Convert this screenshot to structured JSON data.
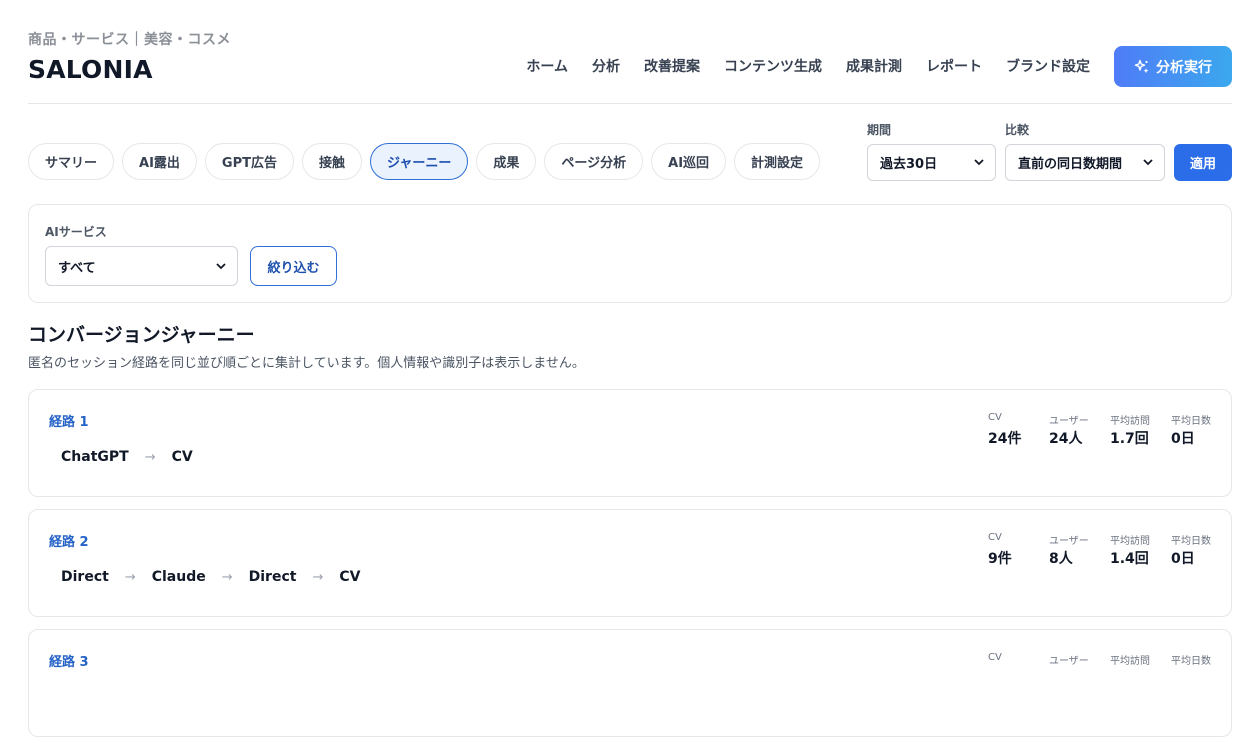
{
  "header": {
    "category": "商品・サービス｜美容・コスメ",
    "brand": "SALONIA",
    "nav": [
      "ホーム",
      "分析",
      "改善提案",
      "コンテンツ生成",
      "成果計測",
      "レポート",
      "ブランド設定"
    ],
    "run_button": "分析実行",
    "run_icon": "sparkle-icon"
  },
  "tabs": [
    "サマリー",
    "AI露出",
    "GPT広告",
    "接触",
    "ジャーニー",
    "成果",
    "ページ分析",
    "AI巡回",
    "計測設定"
  ],
  "active_tab": "ジャーニー",
  "filters": {
    "period_label": "期間",
    "period_value": "過去30日",
    "compare_label": "比較",
    "compare_value": "直前の同日数期間",
    "apply_button": "適用"
  },
  "service_filter": {
    "label": "AIサービス",
    "value": "すべて",
    "button": "絞り込む"
  },
  "section": {
    "title": "コンバージョンジャーニー",
    "description": "匿名のセッション経路を同じ並び順ごとに集計しています。個人情報や識別子は表示しません。"
  },
  "stat_labels": [
    "CV",
    "ユーザー",
    "平均訪問",
    "平均日数"
  ],
  "journeys": [
    {
      "title": "経路 1",
      "steps": [
        "ChatGPT",
        "CV"
      ],
      "stats": [
        "24件",
        "24人",
        "1.7回",
        "0日"
      ]
    },
    {
      "title": "経路 2",
      "steps": [
        "Direct",
        "Claude",
        "Direct",
        "CV"
      ],
      "stats": [
        "9件",
        "8人",
        "1.4回",
        "0日"
      ]
    },
    {
      "title": "経路 3",
      "steps": [],
      "stats": [
        "",
        "",
        "",
        ""
      ]
    }
  ],
  "colors": {
    "accent": "#2b6de8",
    "link": "#2563c7",
    "active_tab_bg": "#eaf2fd",
    "gradient_start": "#4f7cf7",
    "gradient_end": "#3ba8ee"
  }
}
